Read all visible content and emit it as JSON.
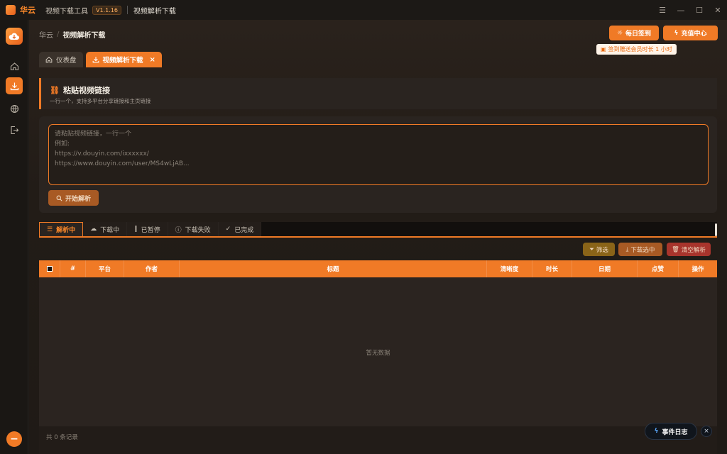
{
  "titlebar": {
    "brand": "华云",
    "app_name": "视频下载工具",
    "version": "V1.1.16",
    "page_name": "视频解析下载"
  },
  "header": {
    "breadcrumb_root": "华云",
    "breadcrumb_sep": "/",
    "breadcrumb_current": "视频解析下载",
    "checkin_label": "每日签到",
    "recharge_label": "充值中心",
    "tooltip": "签到赠送会员时长 1 小时"
  },
  "tabs": [
    {
      "label": "仪表盘"
    },
    {
      "label": "视频解析下载",
      "close": "×"
    }
  ],
  "paste_section": {
    "title": "粘贴视频链接",
    "subtitle": "一行一个，支持多平台分享链接和主页链接"
  },
  "input": {
    "placeholder": "请粘贴视频链接，一行一个\n例如:\nhttps://v.douyin.com/ixxxxxx/\nhttps://www.douyin.com/user/MS4wLjAB...",
    "start_label": "开始解析"
  },
  "status_tabs": [
    {
      "label": "解析中"
    },
    {
      "label": "下载中"
    },
    {
      "label": "已暂停"
    },
    {
      "label": "下载失败"
    },
    {
      "label": "已完成"
    }
  ],
  "actions": {
    "filter_label": "筛选",
    "download_selected_label": "下载选中",
    "clear_label": "清空解析"
  },
  "table": {
    "headers": [
      "#",
      "平台",
      "作者",
      "标题",
      "清晰度",
      "时长",
      "日期",
      "点赞",
      "操作"
    ],
    "empty_text": "暂无数据",
    "total_text": "共 0 条记录"
  },
  "event_log": {
    "label": "事件日志",
    "close": "×"
  },
  "colors": {
    "accent": "#f07a26",
    "background": "#1a1714",
    "panel": "#2a2420"
  }
}
